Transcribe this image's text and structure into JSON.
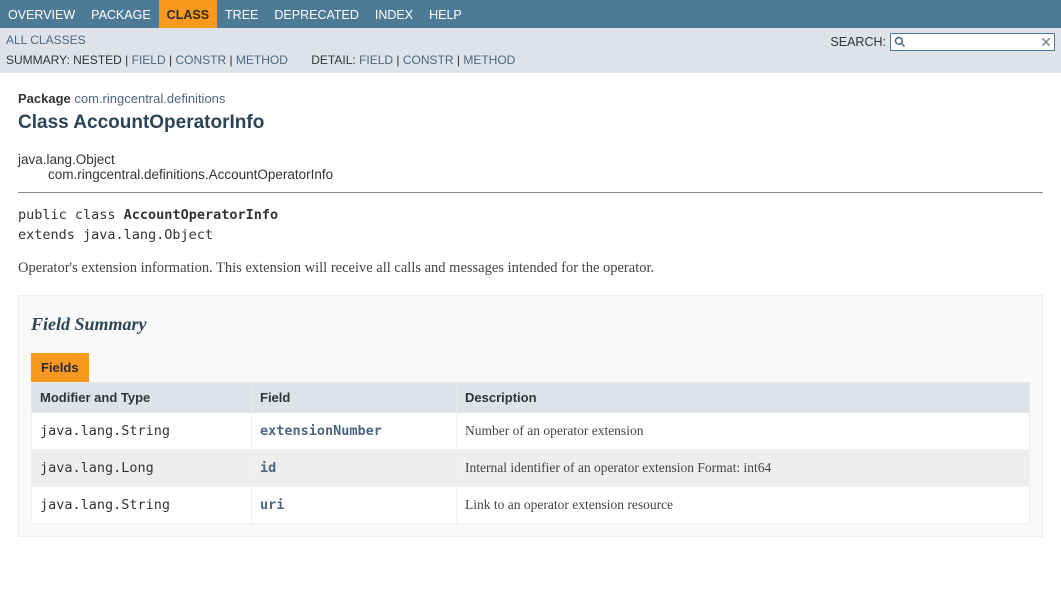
{
  "nav": {
    "items": [
      {
        "label": "OVERVIEW",
        "active": false
      },
      {
        "label": "PACKAGE",
        "active": false
      },
      {
        "label": "CLASS",
        "active": true
      },
      {
        "label": "TREE",
        "active": false
      },
      {
        "label": "DEPRECATED",
        "active": false
      },
      {
        "label": "INDEX",
        "active": false
      },
      {
        "label": "HELP",
        "active": false
      }
    ]
  },
  "subnav": {
    "all_classes": "ALL CLASSES",
    "summary_label": "SUMMARY:",
    "summary_nested": "NESTED",
    "summary_field": "FIELD",
    "summary_constr": "CONSTR",
    "summary_method": "METHOD",
    "detail_label": "DETAIL:",
    "detail_field": "FIELD",
    "detail_constr": "CONSTR",
    "detail_method": "METHOD"
  },
  "search": {
    "label": "SEARCH:",
    "value": "",
    "placeholder": ""
  },
  "header": {
    "package_label": "Package",
    "package_link": "com.ringcentral.definitions",
    "class_title": "Class AccountOperatorInfo"
  },
  "inheritance": {
    "parent": "java.lang.Object",
    "self": "com.ringcentral.definitions.AccountOperatorInfo"
  },
  "declaration": {
    "prefix": "public class ",
    "name": "AccountOperatorInfo",
    "extends": "extends java.lang.Object"
  },
  "description": "Operator's extension information. This extension will receive all calls and messages intended for the operator.",
  "field_summary": {
    "heading": "Field Summary",
    "tab": "Fields",
    "cols": {
      "modifier": "Modifier and Type",
      "field": "Field",
      "desc": "Description"
    },
    "rows": [
      {
        "modifier": "java.lang.String",
        "field": "extensionNumber",
        "desc": "Number of an operator extension"
      },
      {
        "modifier": "java.lang.Long",
        "field": "id",
        "desc": "Internal identifier of an operator extension Format: int64"
      },
      {
        "modifier": "java.lang.String",
        "field": "uri",
        "desc": "Link to an operator extension resource"
      }
    ]
  }
}
